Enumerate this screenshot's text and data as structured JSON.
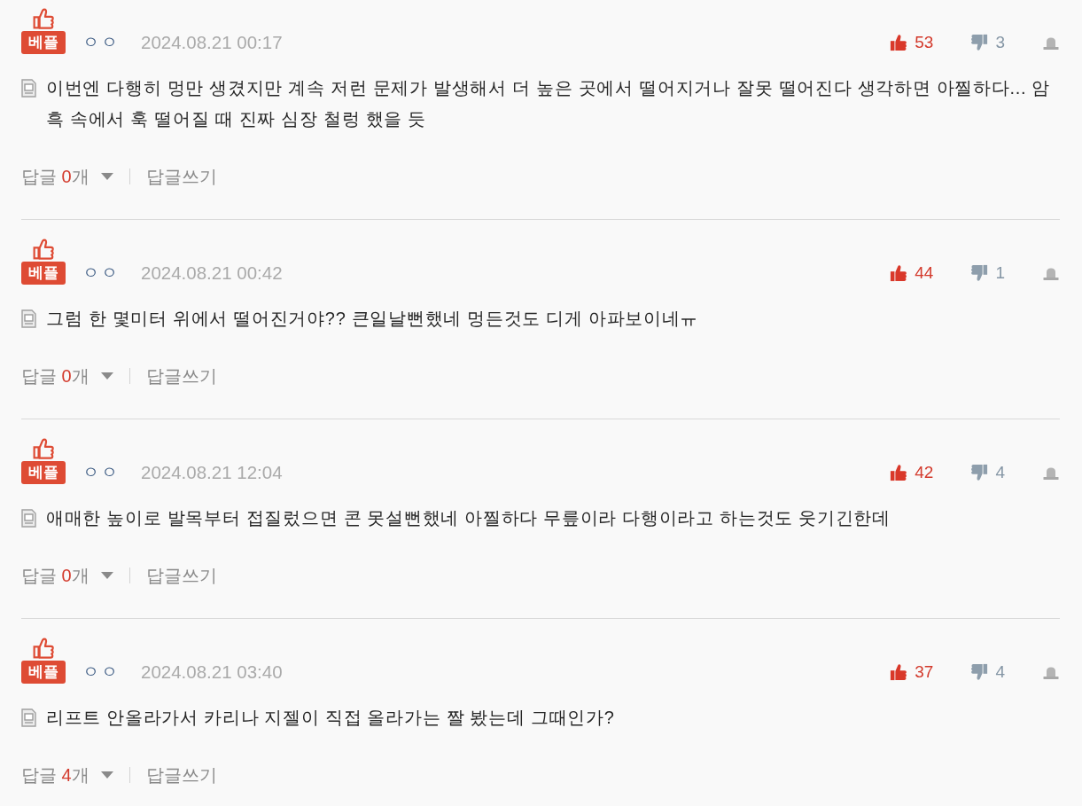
{
  "comments": [
    {
      "badge": "베플",
      "author": "ㅇㅇ",
      "date": "2024.08.21 00:17",
      "likes": "53",
      "dislikes": "3",
      "text": "이번엔 다행히 멍만 생겼지만 계속 저런 문제가 발생해서 더 높은 곳에서 떨어지거나 잘못 떨어진다 생각하면 아찔하다... 암흑 속에서 훅 떨어질 때 진짜 심장 철렁 했을 듯",
      "reply_label": "답글",
      "reply_count": "0",
      "reply_unit": "개",
      "write_reply": "답글쓰기"
    },
    {
      "badge": "베플",
      "author": "ㅇㅇ",
      "date": "2024.08.21 00:42",
      "likes": "44",
      "dislikes": "1",
      "text": "그럼 한 몇미터 위에서 떨어진거야?? 큰일날뻔했네 멍든것도 디게 아파보이네ㅠ",
      "reply_label": "답글",
      "reply_count": "0",
      "reply_unit": "개",
      "write_reply": "답글쓰기"
    },
    {
      "badge": "베플",
      "author": "ㅇㅇ",
      "date": "2024.08.21 12:04",
      "likes": "42",
      "dislikes": "4",
      "text": "애매한 높이로 발목부터 접질렀으면 콘 못설뻔했네 아찔하다 무릎이라 다행이라고 하는것도 웃기긴한데",
      "reply_label": "답글",
      "reply_count": "0",
      "reply_unit": "개",
      "write_reply": "답글쓰기"
    },
    {
      "badge": "베플",
      "author": "ㅇㅇ",
      "date": "2024.08.21 03:40",
      "likes": "37",
      "dislikes": "4",
      "text": "리프트 안올라가서 카리나 지젤이 직접 올라가는 짤 봤는데 그때인가?",
      "reply_label": "답글",
      "reply_count": "4",
      "reply_unit": "개",
      "write_reply": "답글쓰기"
    }
  ]
}
